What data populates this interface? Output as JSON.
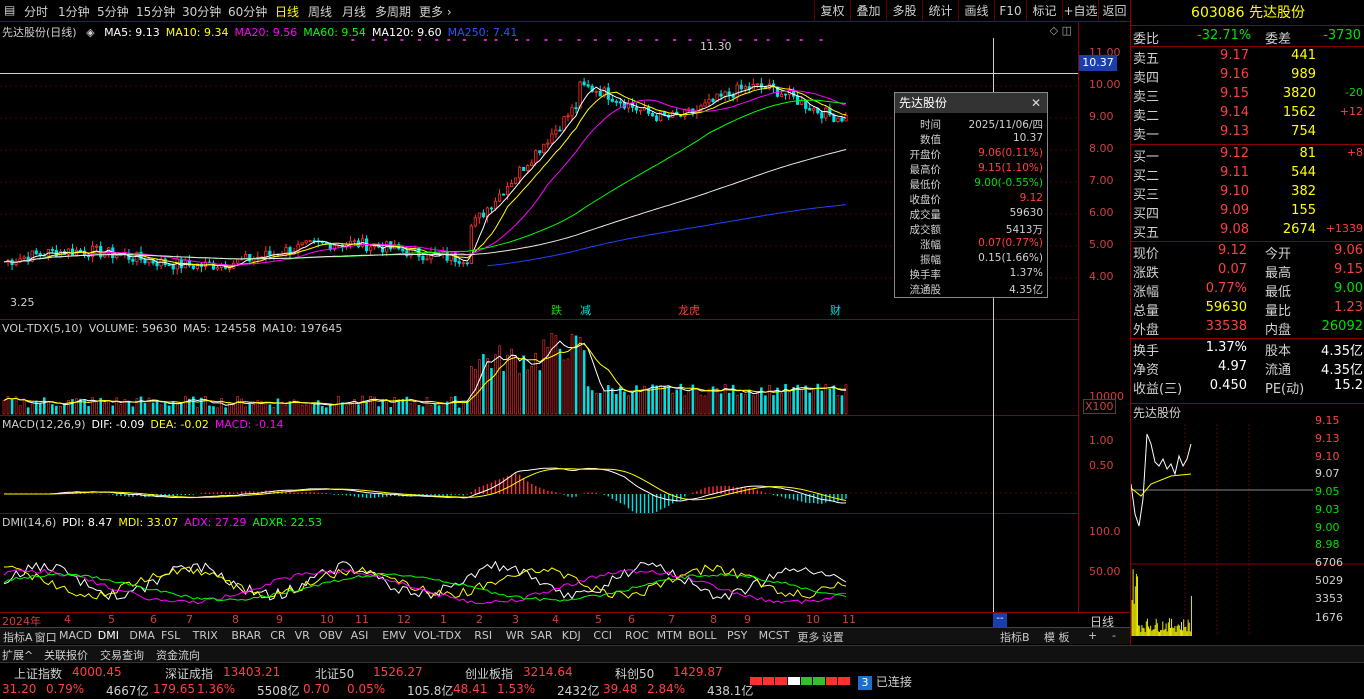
{
  "toolbar": {
    "periods": [
      "分时",
      "1分钟",
      "5分钟",
      "15分钟",
      "30分钟",
      "60分钟",
      "日线",
      "周线",
      "月线",
      "多周期",
      "更多 ›"
    ],
    "active_period": "日线",
    "right_buttons": [
      "复权",
      "叠加",
      "多股",
      "统计",
      "画线",
      "F10",
      "标记",
      "+自选",
      "返回"
    ]
  },
  "main_header": {
    "stock": "先达股份(日线)",
    "ma": [
      {
        "label": "MA5: 9.13",
        "color": "#ffffff"
      },
      {
        "label": "MA10: 9.34",
        "color": "#ffff00"
      },
      {
        "label": "MA20: 9.56",
        "color": "#ff00ff"
      },
      {
        "label": "MA60: 9.54",
        "color": "#00ff00"
      },
      {
        "label": "MA120: 9.60",
        "color": "#ffffff"
      },
      {
        "label": "MA250: 7.41",
        "color": "#3050ff"
      }
    ],
    "high_label": "11.30",
    "low_label": "3.25",
    "crosshair_value": "10.37",
    "event_tags": [
      "跌",
      "减",
      "龙虎",
      "财"
    ]
  },
  "price_axis": [
    "11.00",
    "10.00",
    "9.00",
    "8.00",
    "7.00",
    "6.00",
    "5.00",
    "4.00"
  ],
  "volume": {
    "header": [
      "VOL-TDX(5,10)",
      "VOLUME: 59630",
      "MA5: 124558",
      "MA10: 197645"
    ],
    "axis": [
      "10000"
    ],
    "unit": "X100"
  },
  "macd": {
    "header": [
      "MACD(12,26,9)",
      "DIF: -0.09",
      "DEA: -0.02",
      "MACD: -0.14"
    ],
    "axis": [
      "1.00",
      "0.50"
    ]
  },
  "dmi": {
    "header": [
      "DMI(14,6)",
      "PDI: 8.47",
      "MDI: 33.07",
      "ADX: 27.29",
      "ADXR: 22.53"
    ],
    "axis": [
      "100.0",
      "50.00"
    ]
  },
  "date_axis": {
    "labels": [
      "2024年",
      "4",
      "5",
      "6",
      "7",
      "8",
      "9",
      "10",
      "11",
      "12",
      "1",
      "2",
      "3",
      "4",
      "5",
      "6",
      "7",
      "8",
      "9",
      "10",
      "11"
    ],
    "cursor_label": "--",
    "period_label": "日线"
  },
  "indicator_tabs": [
    "指标A",
    "窗口",
    "MACD",
    "DMI",
    "DMA",
    "FSL",
    "TRIX",
    "BRAR",
    "CR",
    "VR",
    "OBV",
    "ASI",
    "EMV",
    "VOL-TDX",
    "RSI",
    "WR",
    "SAR",
    "KDJ",
    "CCI",
    "ROC",
    "MTM",
    "BOLL",
    "PSY",
    "MCST",
    "更多",
    "设置"
  ],
  "indicator_right_tabs": [
    "指标B",
    "模 板",
    "+",
    "-"
  ],
  "bottom_tabs": [
    "扩展^",
    "关联报价",
    "交易查询",
    "资金流向"
  ],
  "indices": [
    {
      "name": "上证指数",
      "value": "4000.45",
      "change": "31.20",
      "pct": "0.79%",
      "amount": "4667亿"
    },
    {
      "name": "深证成指",
      "value": "13403.21",
      "change": "179.65",
      "pct": "1.36%",
      "amount": "5508亿"
    },
    {
      "name": "北证50",
      "value": "1526.27",
      "change": "0.70",
      "pct": "0.05%",
      "amount": "105.8亿"
    },
    {
      "name": "创业板指",
      "value": "3214.64",
      "change": "48.41",
      "pct": "1.53%",
      "amount": "2432亿"
    },
    {
      "name": "科创50",
      "value": "1429.87",
      "change": "39.48",
      "pct": "2.84%",
      "amount": "438.1亿"
    }
  ],
  "connection": {
    "count": "3",
    "label": "已连接"
  },
  "quote": {
    "code_name": "603086 先达股份",
    "weibi_label": "委比",
    "weibi_value": "-32.71%",
    "weicha_label": "委差",
    "weicha_value": "-3730",
    "asks": [
      {
        "label": "卖五",
        "price": "9.17",
        "vol": "441",
        "chg": ""
      },
      {
        "label": "卖四",
        "price": "9.16",
        "vol": "989",
        "chg": ""
      },
      {
        "label": "卖三",
        "price": "9.15",
        "vol": "3820",
        "chg": "-20"
      },
      {
        "label": "卖二",
        "price": "9.14",
        "vol": "1562",
        "chg": "+12"
      },
      {
        "label": "卖一",
        "price": "9.13",
        "vol": "754",
        "chg": ""
      }
    ],
    "bids": [
      {
        "label": "买一",
        "price": "9.12",
        "vol": "81",
        "chg": "+8"
      },
      {
        "label": "买二",
        "price": "9.11",
        "vol": "544",
        "chg": ""
      },
      {
        "label": "买三",
        "price": "9.10",
        "vol": "382",
        "chg": ""
      },
      {
        "label": "买四",
        "price": "9.09",
        "vol": "155",
        "chg": ""
      },
      {
        "label": "买五",
        "price": "9.08",
        "vol": "2674",
        "chg": "+1339"
      }
    ],
    "stats": [
      {
        "k1": "现价",
        "v1": "9.12",
        "k2": "今开",
        "v2": "9.06"
      },
      {
        "k1": "涨跌",
        "v1": "0.07",
        "k2": "最高",
        "v2": "9.15"
      },
      {
        "k1": "涨幅",
        "v1": "0.77%",
        "k2": "最低",
        "v2": "9.00"
      },
      {
        "k1": "总量",
        "v1": "59630",
        "k2": "量比",
        "v2": "1.23"
      },
      {
        "k1": "外盘",
        "v1": "33538",
        "k2": "内盘",
        "v2": "26092"
      }
    ],
    "stats2": [
      {
        "k1": "换手",
        "v1": "1.37%",
        "k2": "股本",
        "v2": "4.35亿"
      },
      {
        "k1": "净资",
        "v1": "4.97",
        "k2": "流通",
        "v2": "4.35亿"
      },
      {
        "k1": "收益(三)",
        "v1": "0.450",
        "k2": "PE(动)",
        "v2": "15.2"
      }
    ]
  },
  "mini_chart": {
    "title": "先达股份",
    "price_axis": [
      "9.15",
      "9.13",
      "9.10",
      "9.07",
      "9.05",
      "9.03",
      "9.00",
      "8.98"
    ],
    "vol_axis": [
      "6706",
      "5029",
      "3353",
      "1676"
    ]
  },
  "popup": {
    "title": "先达股份",
    "rows": [
      {
        "k": "时间",
        "v": "2025/11/06/四",
        "color": "#d0d0d0"
      },
      {
        "k": "数值",
        "v": "10.37",
        "color": "#d0d0d0"
      },
      {
        "k": "开盘价",
        "v": "9.06(0.11%)",
        "color": "#ff4040"
      },
      {
        "k": "最高价",
        "v": "9.15(1.10%)",
        "color": "#ff4040"
      },
      {
        "k": "最低价",
        "v": "9.00(-0.55%)",
        "color": "#00e000"
      },
      {
        "k": "收盘价",
        "v": "9.12",
        "color": "#ff4040"
      },
      {
        "k": "成交量",
        "v": "59630",
        "color": "#d0d0d0"
      },
      {
        "k": "成交额",
        "v": "5413万",
        "color": "#d0d0d0"
      },
      {
        "k": "涨幅",
        "v": "0.07(0.77%)",
        "color": "#ff4040"
      },
      {
        "k": "振幅",
        "v": "0.15(1.66%)",
        "color": "#d0d0d0"
      },
      {
        "k": "换手率",
        "v": "1.37%",
        "color": "#d0d0d0"
      },
      {
        "k": "流通股",
        "v": "4.35亿",
        "color": "#d0d0d0"
      }
    ]
  }
}
